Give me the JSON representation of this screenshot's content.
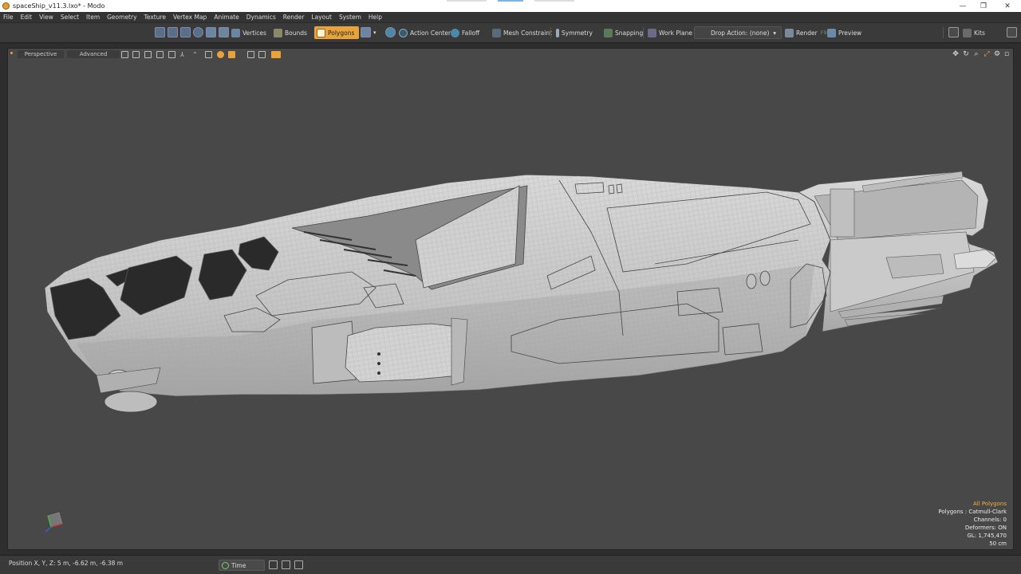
{
  "window": {
    "title": "spaceShip_v11.3.lxo* - Modo",
    "controls": {
      "minimize": "—",
      "restore": "❐",
      "close": "✕"
    }
  },
  "menu": [
    "File",
    "Edit",
    "View",
    "Select",
    "Item",
    "Geometry",
    "Texture",
    "Vertex Map",
    "Animate",
    "Dynamics",
    "Render",
    "Layout",
    "System",
    "Help"
  ],
  "toolbar": {
    "vertices": "Vertices",
    "bounds": "Bounds",
    "polygons": "Polygons",
    "action_center": "Action Center",
    "falloff": "Falloff",
    "mesh_constraint": "Mesh Constraint",
    "symmetry": "Symmetry",
    "snapping": "Snapping",
    "work_plane": "Work Plane",
    "drop_action": "Drop Action: (none)",
    "render": "Render",
    "render_shortcut": "F9",
    "preview": "Preview",
    "kits": "Kits"
  },
  "viewport": {
    "view_mode": "Perspective",
    "advanced": "Advanced",
    "hud": {
      "selection": "All Polygons",
      "polygons": "Polygons : Catmull-Clark",
      "channels": "Channels: 0",
      "deformers": "Deformers: ON",
      "gl": "GL: 1,745,470",
      "scale": "50 cm"
    },
    "colors": {
      "background": "#484848",
      "hull": "#c8c8c8",
      "wire": "#9a9a9a",
      "glass": "#2a2a2a"
    }
  },
  "status": {
    "position": "Position X, Y, Z:   5 m, -6.62 m, -6.38 m",
    "time": "Time"
  }
}
